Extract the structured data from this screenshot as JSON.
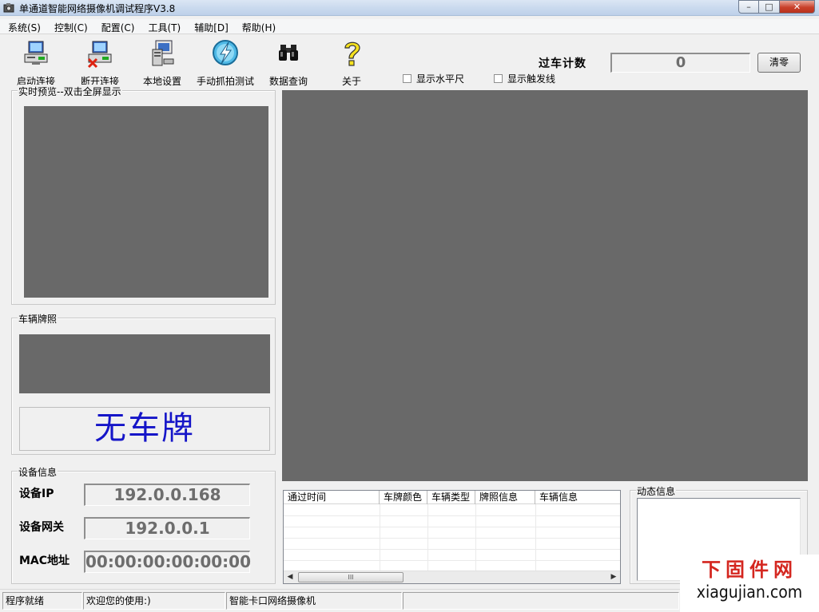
{
  "window": {
    "title": "单通道智能网络摄像机调试程序V3.8",
    "controls": {
      "minimize": "–",
      "maximize": "□",
      "close": "✕"
    }
  },
  "menu": [
    "系统(S)",
    "控制(C)",
    "配置(C)",
    "工具(T)",
    "辅助[D]",
    "帮助(H)"
  ],
  "toolbar": [
    {
      "label": "启动连接",
      "icon": "connect-icon"
    },
    {
      "label": "断开连接",
      "icon": "disconnect-icon"
    },
    {
      "label": "本地设置",
      "icon": "local-settings-icon"
    },
    {
      "label": "手动抓拍测试",
      "icon": "manual-capture-icon"
    },
    {
      "label": "数据查询",
      "icon": "binoculars-icon"
    },
    {
      "label": "关于",
      "icon": "help-icon"
    }
  ],
  "options": {
    "show_level": "显示水平尺",
    "show_trigger": "显示触发线"
  },
  "counter": {
    "label": "过车计数",
    "value": "0",
    "clear": "清零"
  },
  "preview": {
    "legend": "实时预览--双击全屏显示"
  },
  "plate": {
    "legend": "车辆牌照",
    "text": "无车牌",
    "text_color": "#1515c8"
  },
  "device": {
    "legend": "设备信息",
    "ip_label": "设备IP",
    "ip": "192.0.0.168",
    "gateway_label": "设备网关",
    "gateway": "192.0.0.1",
    "mac_label": "MAC地址",
    "mac": "00:00:00:00:00:00"
  },
  "table": {
    "columns": [
      "通过时间",
      "车牌颜色",
      "车辆类型",
      "牌照信息",
      "车辆信息"
    ],
    "rows": [],
    "scroll_thumb": "III"
  },
  "dynamic": {
    "legend": "动态信息"
  },
  "status": {
    "ready": "程序就绪",
    "welcome": "欢迎您的使用:)",
    "device_type": "智能卡口网络摄像机"
  },
  "watermark": {
    "cn": "下固件网",
    "url": "xiagujian.com"
  },
  "colors": {
    "video_bg": "#696969",
    "watermark_red": "#d4261f"
  }
}
